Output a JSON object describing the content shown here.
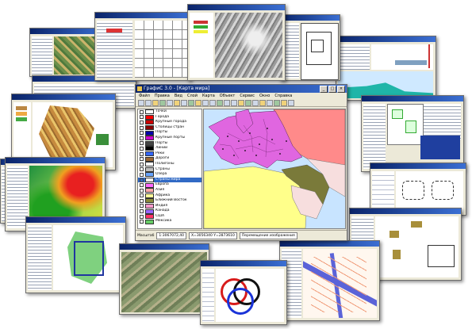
{
  "main_window": {
    "title": "ГрафиС 3.0 - [Карта мира]",
    "menu": [
      "Файл",
      "Правка",
      "Вид",
      "Слой",
      "Карта",
      "Объект",
      "Сервис",
      "Окно",
      "Справка"
    ],
    "layers": [
      {
        "label": "Точки",
        "color": "#ffffff"
      },
      {
        "label": "Города",
        "color": "#ff0000"
      },
      {
        "label": "Крупные города",
        "color": "#cc0000"
      },
      {
        "label": "Столицы стран",
        "color": "#880000"
      },
      {
        "label": "Порты",
        "color": "#0000aa"
      },
      {
        "label": "Крупные порты",
        "color": "#cc00cc"
      },
      {
        "label": "Порты",
        "color": "#444444"
      },
      {
        "label": "Линии",
        "color": "#000000"
      },
      {
        "label": "Реки",
        "color": "#3366ff"
      },
      {
        "label": "Дороги",
        "color": "#996633"
      },
      {
        "label": "Полигоны",
        "color": "#ffffff"
      },
      {
        "label": "Страны",
        "color": "#c0c0c0"
      },
      {
        "label": "Озёра",
        "color": "#66a3ff"
      },
      {
        "label": "Страны мира",
        "color": "#f0f0f0"
      },
      {
        "label": "Европа",
        "color": "#ff66ff"
      },
      {
        "label": "Азия",
        "color": "#ffaaaa"
      },
      {
        "label": "Африка",
        "color": "#ffff99"
      },
      {
        "label": "Ближний Восток",
        "color": "#8a8a3a"
      },
      {
        "label": "Индия",
        "color": "#ff99cc"
      },
      {
        "label": "Канада",
        "color": "#9966ff"
      },
      {
        "label": "США",
        "color": "#ff3366"
      },
      {
        "label": "Мексика",
        "color": "#66cc66"
      }
    ],
    "status": {
      "scale_label": "Масштаб",
      "scale_value": "1:3067072,40",
      "coords": "X=3056340 Y=2873610",
      "mode": "Перемещение изображения"
    }
  },
  "colors": {
    "title_bar": "#0a246a",
    "europe": "#e066e0",
    "asia": "#ff8a8a",
    "africa": "#ffff8a",
    "middle_east": "#7a7a3a",
    "sea": "#c8e4ff",
    "land_other": "#f7dede",
    "selection": "#316ac5"
  }
}
